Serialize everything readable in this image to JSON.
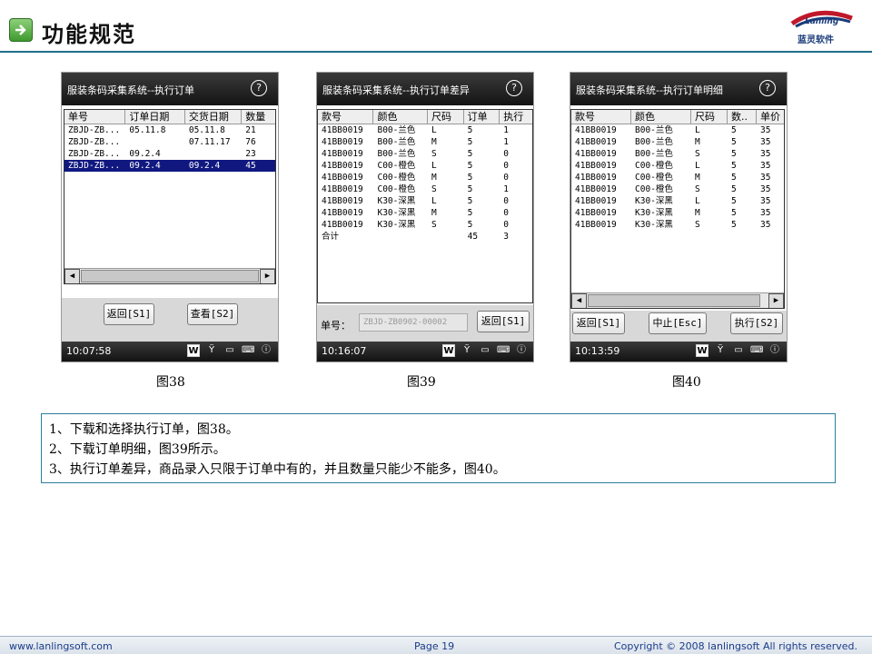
{
  "header": {
    "title": "功能规范",
    "logo_brand": "Lanling",
    "logo_text": "蓝灵软件"
  },
  "screens": [
    {
      "title": "服装条码采集系统--执行订单",
      "help": "?",
      "time": "10:07:58",
      "columns": [
        "单号",
        "订单日期",
        "交货日期",
        "数量"
      ],
      "rows": [
        [
          "ZBJD-ZB...",
          "05.11.8",
          "05.11.8",
          "21"
        ],
        [
          "ZBJD-ZB...",
          "",
          "07.11.17",
          "76"
        ],
        [
          "ZBJD-ZB...",
          "09.2.4",
          "",
          "23"
        ],
        [
          "ZBJD-ZB...",
          "09.2.4",
          "09.2.4",
          "45"
        ]
      ],
      "selected_row": 3,
      "buttons": [
        "返回[S1]",
        "查看[S2]"
      ],
      "caption": "图38"
    },
    {
      "title": "服装条码采集系统--执行订单差异",
      "help": "?",
      "time": "10:16:07",
      "columns": [
        "款号",
        "颜色",
        "尺码",
        "订单",
        "执行"
      ],
      "rows": [
        [
          "41BB0019",
          "B00-兰色",
          "L",
          "5",
          "1"
        ],
        [
          "41BB0019",
          "B00-兰色",
          "M",
          "5",
          "1"
        ],
        [
          "41BB0019",
          "B00-兰色",
          "S",
          "5",
          "0"
        ],
        [
          "41BB0019",
          "C00-橙色",
          "L",
          "5",
          "0"
        ],
        [
          "41BB0019",
          "C00-橙色",
          "M",
          "5",
          "0"
        ],
        [
          "41BB0019",
          "C00-橙色",
          "S",
          "5",
          "1"
        ],
        [
          "41BB0019",
          "K30-深黑",
          "L",
          "5",
          "0"
        ],
        [
          "41BB0019",
          "K30-深黑",
          "M",
          "5",
          "0"
        ],
        [
          "41BB0019",
          "K30-深黑",
          "S",
          "5",
          "0"
        ],
        [
          "合计",
          "",
          "",
          "45",
          "3"
        ]
      ],
      "order_label": "单号：",
      "order_value": "ZBJD-ZB0902-00002",
      "buttons": [
        "返回[S1]"
      ],
      "caption": "图39"
    },
    {
      "title": "服装条码采集系统--执行订单明细",
      "help": "?",
      "time": "10:13:59",
      "columns": [
        "款号",
        "颜色",
        "尺码",
        "数..",
        "单价"
      ],
      "rows": [
        [
          "41BB0019",
          "B00-兰色",
          "L",
          "5",
          "35"
        ],
        [
          "41BB0019",
          "B00-兰色",
          "M",
          "5",
          "35"
        ],
        [
          "41BB0019",
          "B00-兰色",
          "S",
          "5",
          "35"
        ],
        [
          "41BB0019",
          "C00-橙色",
          "L",
          "5",
          "35"
        ],
        [
          "41BB0019",
          "C00-橙色",
          "M",
          "5",
          "35"
        ],
        [
          "41BB0019",
          "C00-橙色",
          "S",
          "5",
          "35"
        ],
        [
          "41BB0019",
          "K30-深黑",
          "L",
          "5",
          "35"
        ],
        [
          "41BB0019",
          "K30-深黑",
          "M",
          "5",
          "35"
        ],
        [
          "41BB0019",
          "K30-深黑",
          "S",
          "5",
          "35"
        ]
      ],
      "buttons": [
        "返回[S1]",
        "中止[Esc]",
        "执行[S2]"
      ],
      "caption": "图40"
    }
  ],
  "notes": [
    "1、下载和选择执行订单，图38。",
    "2、下载订单明细，图39所示。",
    "3、执行订单差异，商品录入只限于订单中有的，并且数量只能少不能多，图40。"
  ],
  "footer": {
    "site": "www.lanlingsoft.com",
    "page": "Page 19",
    "copyright": "Copyright © 2008 lanlingsoft All rights reserved."
  }
}
